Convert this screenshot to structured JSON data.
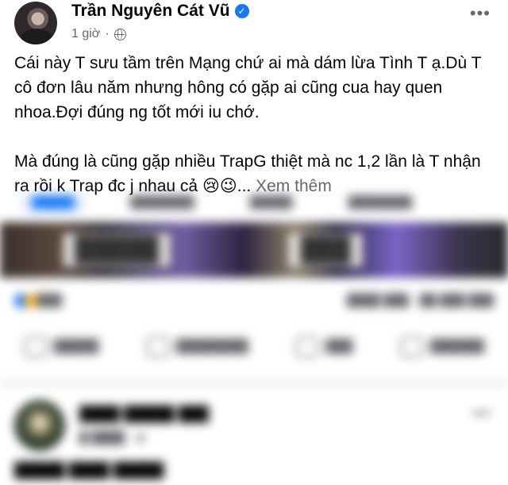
{
  "post": {
    "author": "Trần Nguyên Cát Vũ",
    "time": "1 giờ",
    "more": "•••",
    "paragraph1": "Cái này T sưu tầm trên Mạng chứ ai mà dám lừa Tình T ạ.Dù T cô đơn lâu năm nhưng hông có gặp ai cũng cua hay quen nhoa.Đợi đúng ng tốt mới iu chớ.",
    "paragraph2": "Mà đúng là cũng gặp nhiều TrapG thiệt mà nc 1,2 lần là T nhận ra rồi k Trap đc j nhau cả",
    "emoji": "😢😉",
    "ellipsis": "...",
    "see_more": "Xem thêm"
  },
  "colors": {
    "text": "#050505",
    "secondary": "#65676b",
    "accent": "#1877f2"
  },
  "icons": [
    "verified-badge-icon",
    "globe-icon",
    "more-options-icon"
  ]
}
